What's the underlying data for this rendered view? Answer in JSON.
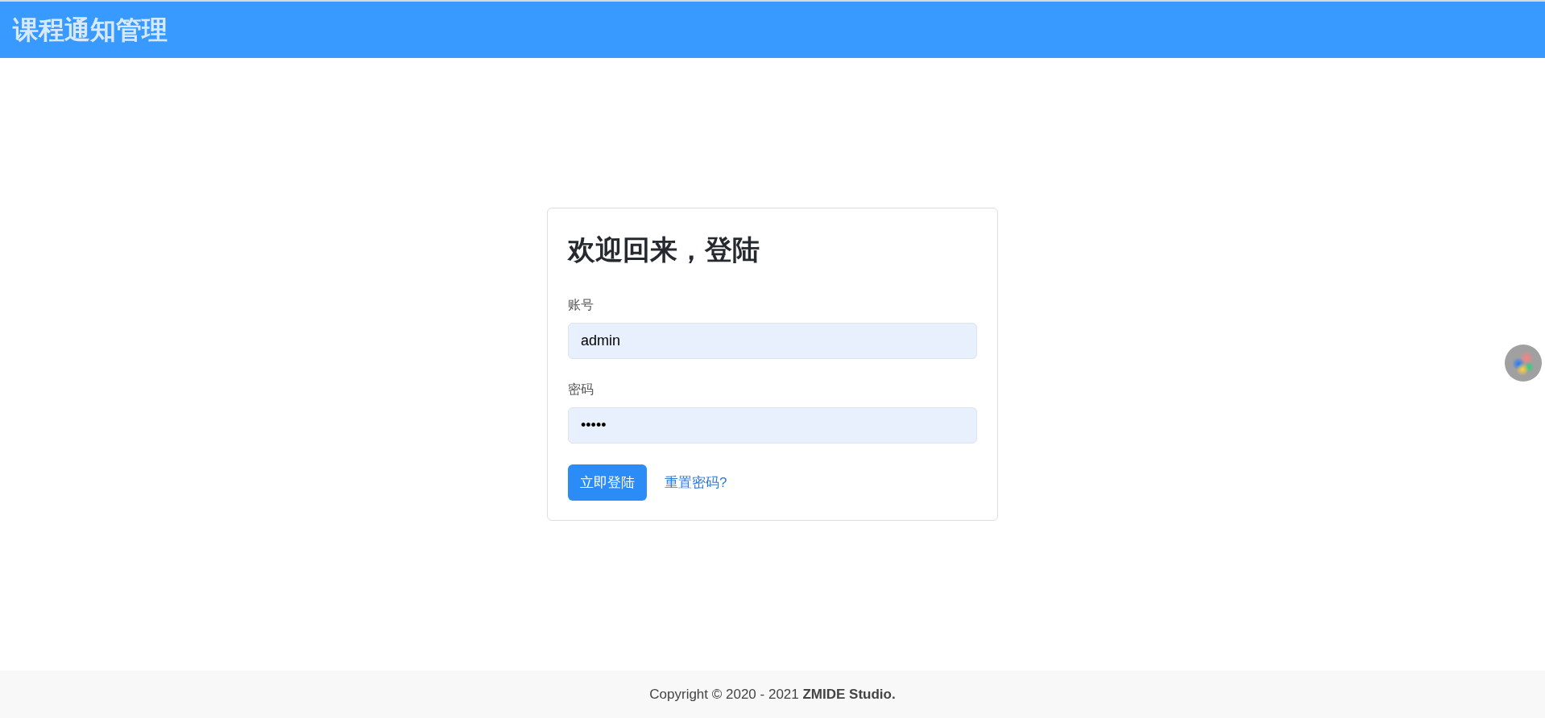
{
  "header": {
    "title": "课程通知管理"
  },
  "login_card": {
    "title": "欢迎回来，登陆",
    "fields": [
      {
        "label": "账号",
        "value": "admin"
      },
      {
        "label": "密码",
        "value": "•••••"
      }
    ],
    "submit_button": "立即登陆",
    "reset_link": "重置密码?"
  },
  "footer": {
    "text": "Copyright © 2020 - 2021 **ZMIDE Studio.**"
  }
}
